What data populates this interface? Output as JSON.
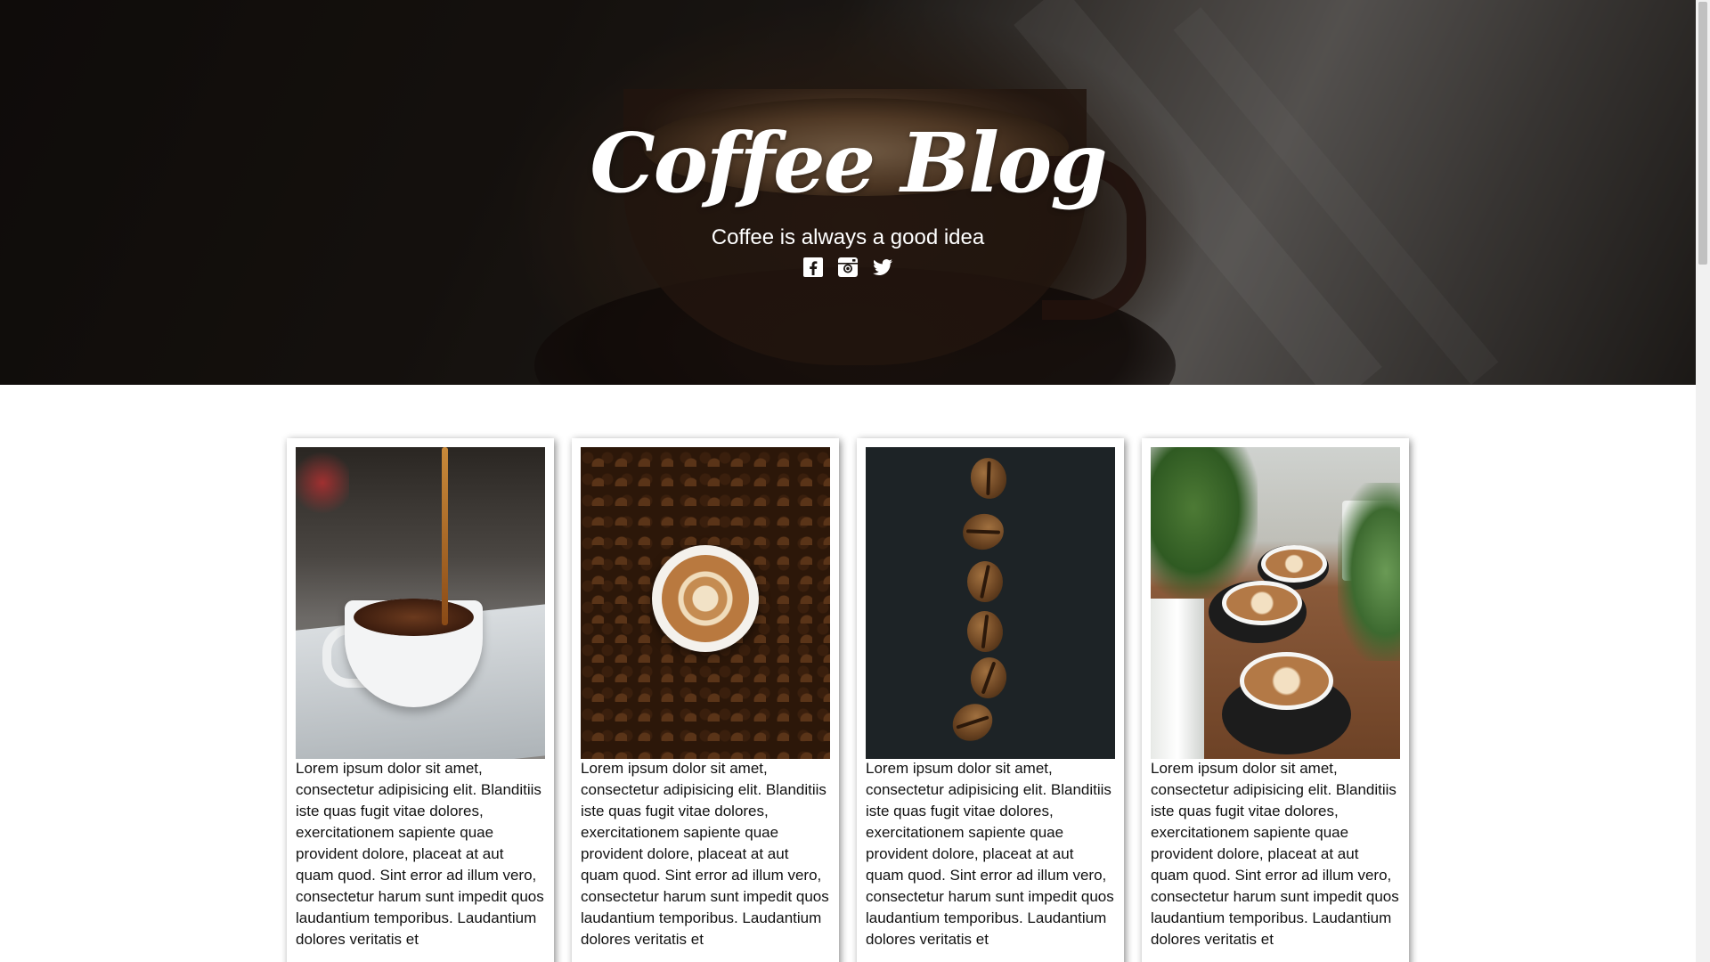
{
  "hero": {
    "title": "Coffee Blog",
    "subtitle": "Coffee is always a good idea",
    "social": [
      {
        "icon": "facebook-icon"
      },
      {
        "icon": "instagram-icon"
      },
      {
        "icon": "twitter-icon"
      }
    ]
  },
  "cards": [
    {
      "image": "coffee-pour-image",
      "text": "Lorem ipsum dolor sit amet, consectetur adipisicing elit. Blanditiis iste quas fugit vitae dolores, exercitationem sapiente quae provident dolore, placeat at aut quam quod. Sint error ad illum vero, consectetur harum sunt impedit quos laudantium temporibus. Laudantium dolores veritatis et"
    },
    {
      "image": "latte-on-beans-image",
      "text": "Lorem ipsum dolor sit amet, consectetur adipisicing elit. Blanditiis iste quas fugit vitae dolores, exercitationem sapiente quae provident dolore, placeat at aut quam quod. Sint error ad illum vero, consectetur harum sunt impedit quos laudantium temporibus. Laudantium dolores veritatis et"
    },
    {
      "image": "coffee-beans-line-image",
      "text": "Lorem ipsum dolor sit amet, consectetur adipisicing elit. Blanditiis iste quas fugit vitae dolores, exercitationem sapiente quae provident dolore, placeat at aut quam quod. Sint error ad illum vero, consectetur harum sunt impedit quos laudantium temporibus. Laudantium dolores veritatis et"
    },
    {
      "image": "cafe-table-image",
      "text": "Lorem ipsum dolor sit amet, consectetur adipisicing elit. Blanditiis iste quas fugit vitae dolores, exercitationem sapiente quae provident dolore, placeat at aut quam quod. Sint error ad illum vero, consectetur harum sunt impedit quos laudantium temporibus. Laudantium dolores veritatis et"
    }
  ],
  "colors": {
    "hero_text": "#ffffff",
    "body_text": "#111111",
    "background": "#ffffff"
  }
}
